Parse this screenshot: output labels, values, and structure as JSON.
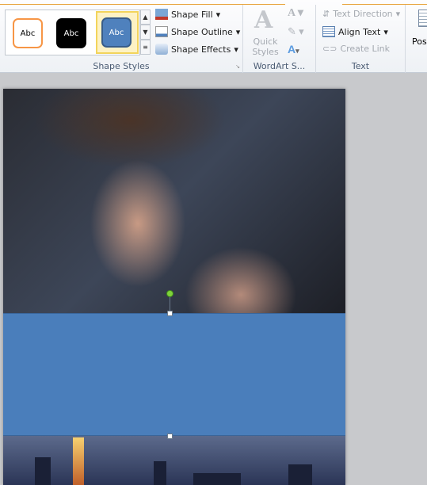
{
  "ribbon": {
    "shape_styles": {
      "label": "Shape Styles",
      "gallery": [
        {
          "text": "Abc",
          "fill": "#ffffff",
          "border": "#f79646"
        },
        {
          "text": "Abc",
          "fill": "#000000",
          "border": "#000000"
        },
        {
          "text": "Abc",
          "fill": "#4f81bd",
          "border": "#385d8a",
          "selected": true
        }
      ],
      "shape_fill": "Shape Fill",
      "shape_outline": "Shape Outline",
      "shape_effects": "Shape Effects"
    },
    "wordart": {
      "label": "WordArt S...",
      "quick_styles": "Quick Styles"
    },
    "text": {
      "label": "Text",
      "text_direction": "Text Direction",
      "align_text": "Align Text",
      "create_link": "Create Link"
    },
    "arrange": {
      "position": "Pos"
    }
  },
  "colors": {
    "shape": "#4a7ebb",
    "accent": "#e8a33a"
  }
}
